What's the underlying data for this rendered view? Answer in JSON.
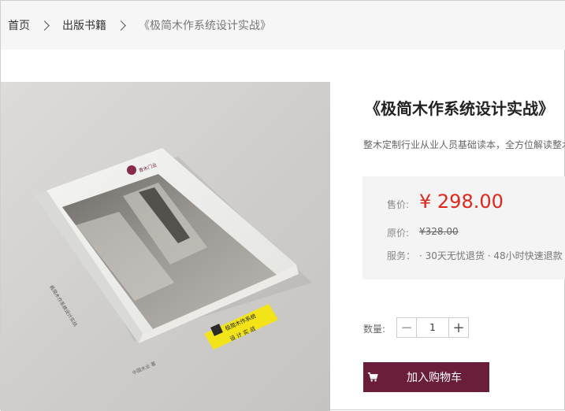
{
  "breadcrumb": {
    "home": "首页",
    "category": "出版书籍",
    "current": "《极简木作系统设计实战》"
  },
  "product": {
    "title": "《极简木作系统设计实战》",
    "subtitle": "整木定制行业从业人员基础读本，全方位解读整木",
    "book_cover": {
      "logo_text": "青木门业",
      "sticker_line1": "极简木作系统",
      "sticker_line2": "设 计 实 战",
      "spine_text": "极简木作系统设计实战",
      "publisher_mark": "中国木业 著"
    }
  },
  "pricing": {
    "price_label": "售价:",
    "price": "¥ 298.00",
    "original_label": "原价:",
    "original_price": "¥328.00",
    "service_label": "服务：",
    "services": "· 30天无忧退货 · 48小时快速退款 ·"
  },
  "purchase": {
    "quantity_label": "数量:",
    "quantity_value": "1",
    "minus": "−",
    "plus": "+",
    "add_to_cart": "加入购物车"
  },
  "colors": {
    "accent_price": "#e0251b",
    "cart_button": "#6b1d3c",
    "sticker": "#f2e419"
  },
  "icons": {
    "breadcrumb_separator": "chevron-right-icon",
    "cart": "cart-icon"
  }
}
